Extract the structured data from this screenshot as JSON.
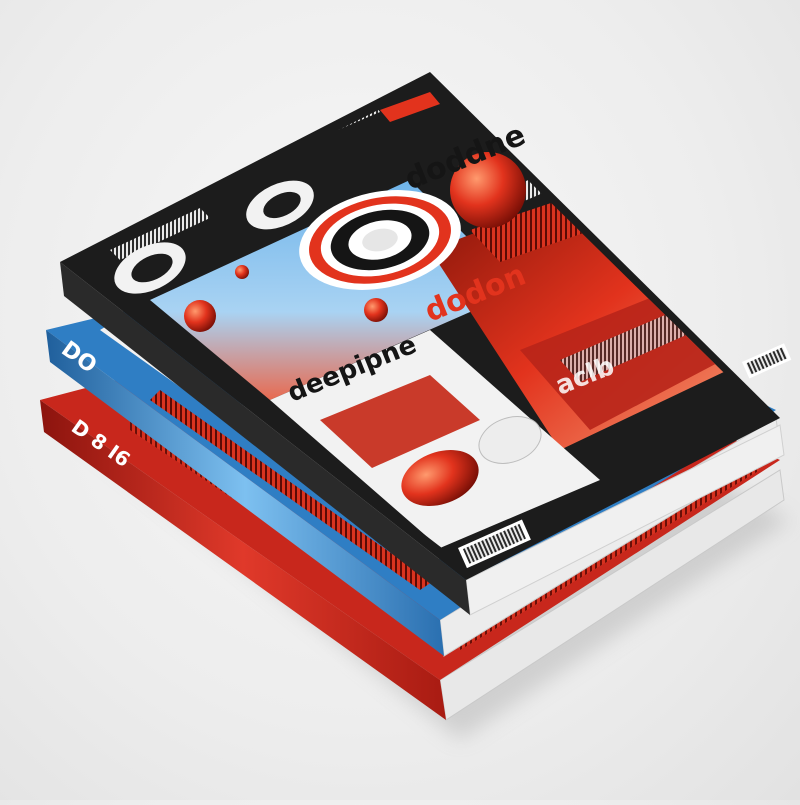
{
  "image": {
    "subject": "stack of three magazines",
    "background_color": "#ededed"
  },
  "magazines": [
    {
      "position": "bottom",
      "cover_color": "#c8271c",
      "spine_text": "D 8 I6"
    },
    {
      "position": "middle",
      "cover_color": "#2f7ec4",
      "spine_text": "DO"
    },
    {
      "position": "top",
      "cover_color": "#1c1c1c",
      "masthead_text": "doddne",
      "headline_text": "dodon",
      "feature_text": "deepipne",
      "secondary_text": "aclb"
    }
  ],
  "colors": {
    "accent": "#e2331d",
    "black": "#151515",
    "blue": "#4a9ad8",
    "paper": "#f2f2f2"
  },
  "icons": [
    "barcode-icon",
    "target-logo-icon"
  ]
}
